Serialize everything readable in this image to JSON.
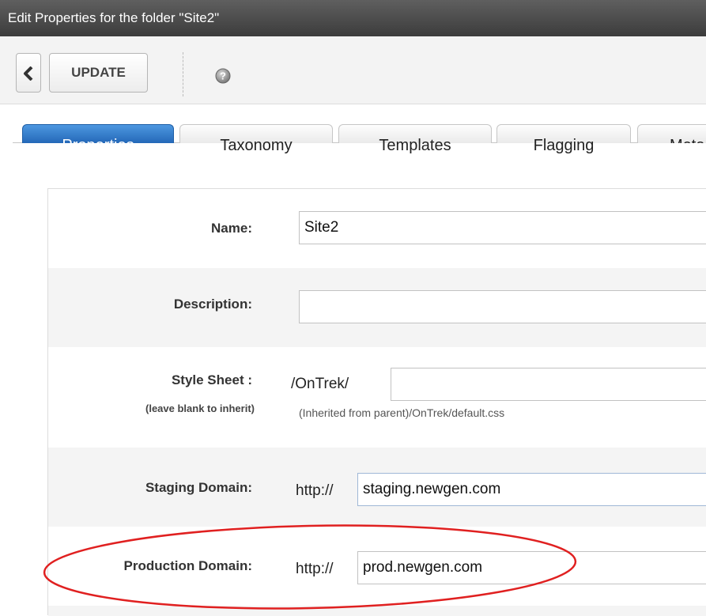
{
  "window": {
    "title": "Edit Properties for the folder \"Site2\""
  },
  "toolbar": {
    "update_label": "UPDATE"
  },
  "tabs": [
    {
      "label": "Properties",
      "active": true
    },
    {
      "label": "Taxonomy",
      "active": false
    },
    {
      "label": "Templates",
      "active": false
    },
    {
      "label": "Flagging",
      "active": false
    },
    {
      "label": "Meta",
      "active": false
    }
  ],
  "form": {
    "name": {
      "label": "Name:",
      "value": "Site2"
    },
    "description": {
      "label": "Description:",
      "value": ""
    },
    "stylesheet": {
      "label": "Style Sheet :",
      "sublabel": "(leave blank to inherit)",
      "prefix": "/OnTrek/",
      "value": "",
      "note": "(Inherited from parent)/OnTrek/default.css"
    },
    "staging": {
      "label": "Staging Domain:",
      "prefix": "http://",
      "value": "staging.newgen.com"
    },
    "production": {
      "label": "Production Domain:",
      "prefix": "http://",
      "value": "prod.newgen.com"
    }
  },
  "colors": {
    "active_tab": "#2f78c4",
    "title_bar": "#4a4a4a",
    "highlight_ellipse": "#e02020"
  }
}
